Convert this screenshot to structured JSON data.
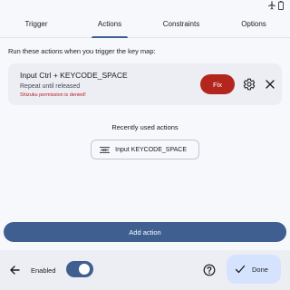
{
  "tabs": [
    {
      "label": "Trigger"
    },
    {
      "label": "Actions"
    },
    {
      "label": "Constraints"
    },
    {
      "label": "Options"
    }
  ],
  "selected_tab": "Actions",
  "intro_text": "Run these actions when you trigger the key map:",
  "action": {
    "title": "Input Ctrl + KEYCODE_SPACE",
    "subtitle": "Repeat until released",
    "error": "Shizuku permission is denied!",
    "fix_label": "Fix"
  },
  "recent": {
    "title": "Recently used actions",
    "chip_icon_text": "⌨",
    "chip_label": "Input KEYCODE_SPACE"
  },
  "add_action_label": "Add action",
  "bottom": {
    "enabled_label": "Enabled",
    "enabled": true,
    "done_label": "Done"
  },
  "colors": {
    "primary": "#3f5f90",
    "error": "#b3261e",
    "done_bg": "#d6e3ff"
  }
}
